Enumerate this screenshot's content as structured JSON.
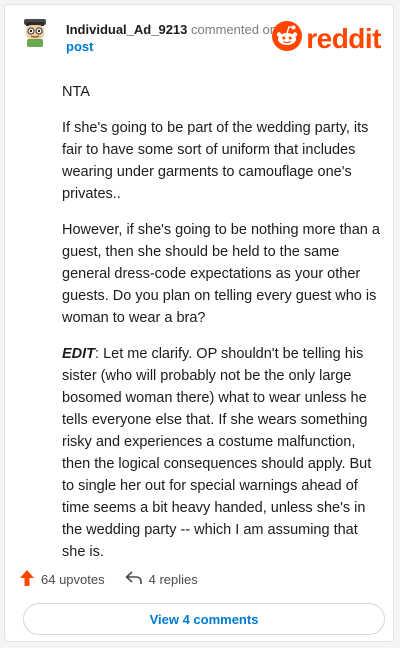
{
  "comment": {
    "username": "Individual_Ad_9213",
    "commented_on_text": "commented on",
    "post_link_label": "post",
    "brand_name": "reddit",
    "paragraphs": [
      "NTA",
      "If she's going to be part of the wedding party, its fair to have some sort of uniform that includes wearing under garments to camouflage one's privates..",
      "However, if she's going to be nothing more than a guest, then she should be held to the same general dress-code expectations as your other guests. Do you plan on telling every guest who is woman to wear a bra?"
    ],
    "edit_label": "EDIT",
    "edit_text": ": Let me clarify. OP shouldn't be telling his sister (who will probably not be the only large bosomed woman there) what to wear unless he tells everyone else that. If she wears something risky and experiences a costume malfunction, then the logical consequences should apply. But to single her out for special warnings ahead of time seems a bit heavy handed, unless she's in the wedding party -- which I am assuming that she is."
  },
  "actions": {
    "upvotes_label": "64 upvotes",
    "replies_label": "4 replies",
    "view_comments_label": "View 4 comments"
  },
  "colors": {
    "brand": "#ff4500",
    "link": "#0079d3",
    "text": "#1c1c1c",
    "muted": "#7c7c7c"
  },
  "icons": [
    "avatar",
    "reddit-logo-icon",
    "upvote-arrow-icon",
    "reply-arrow-icon"
  ]
}
